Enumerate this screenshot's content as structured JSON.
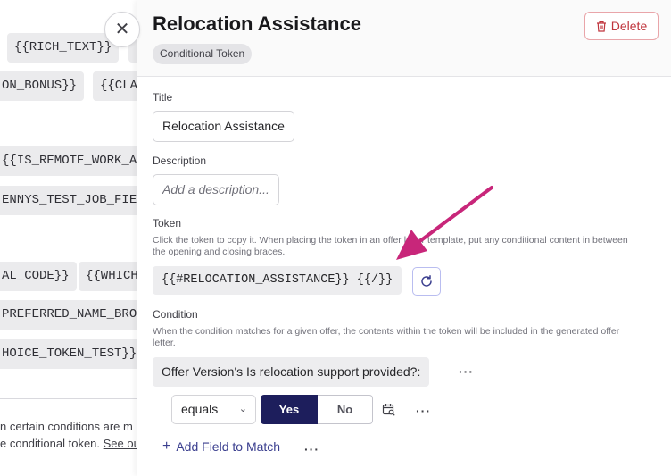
{
  "background": {
    "chips": [
      "{{RICH_TEXT}}",
      "ON_BONUS}}",
      "{{CLA",
      "{{IS_REMOTE_WORK_AN",
      "ENNYS_TEST_JOB_FIEL",
      "AL_CODE}}",
      "{{WHICH",
      "PREFERRED_NAME_BROC",
      "HOICE_TOKEN_TEST}}"
    ],
    "footer_line1": "n certain conditions are m",
    "footer_line2_prefix": "e conditional token. ",
    "footer_line2_link": "See ou"
  },
  "drawer": {
    "title": "Relocation Assistance",
    "badge": "Conditional Token",
    "delete_label": "Delete",
    "title_label": "Title",
    "title_value": "Relocation Assistance",
    "description_label": "Description",
    "description_placeholder": "Add a description...",
    "token_label": "Token",
    "token_help_line1": "Click the token to copy it. When placing the token in an offer letter template, put any conditional content in between",
    "token_help_line2": "the opening and closing braces.",
    "token_value": "{{#RELOCATION_ASSISTANCE}} {{/}}",
    "condition_label": "Condition",
    "condition_help_line1": "When the condition matches for a given offer, the contents within the token will be included in the generated offer",
    "condition_help_line2": "letter.",
    "condition_field": "Offer Version's Is relocation support provided?:",
    "operator_value": "equals",
    "yes_label": "Yes",
    "no_label": "No",
    "add_field_label": "Add Field to Match",
    "more_dots": "···"
  },
  "colors": {
    "accent_navy": "#1d1e5c",
    "delete_red": "#c0353d",
    "annotation_arrow": "#c8267a"
  },
  "icons": {
    "close": "close-icon",
    "delete": "trash-icon",
    "refresh": "refresh-icon",
    "chevron": "chevron-down-icon",
    "calendar": "calendar-search-icon",
    "plus": "plus-icon",
    "more": "more-horizontal-icon"
  }
}
